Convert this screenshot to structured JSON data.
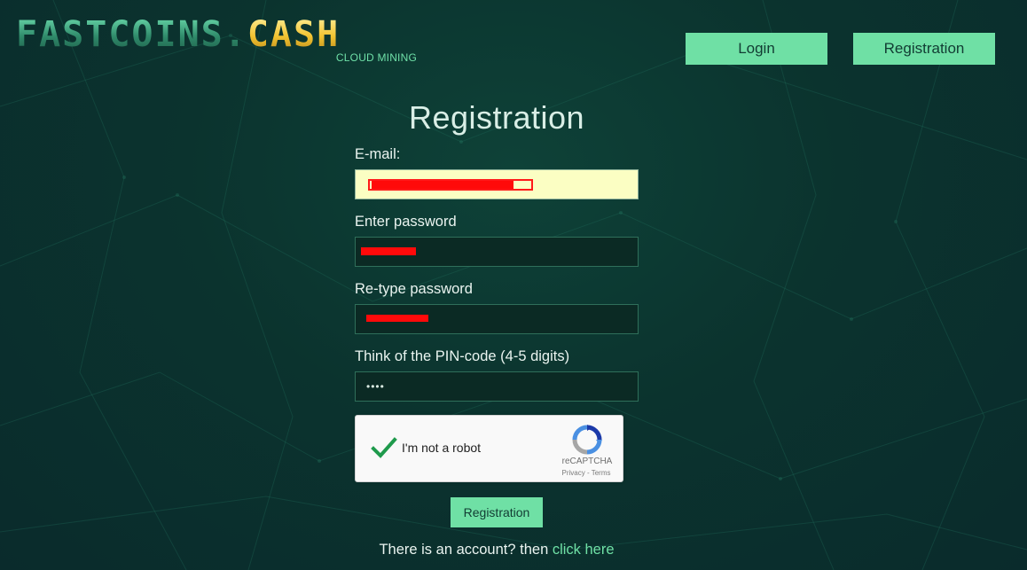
{
  "brand": {
    "logo_part1": "FASTCOINS.",
    "logo_part2": "CASH",
    "tagline": "CLOUD MINING"
  },
  "header": {
    "login_label": "Login",
    "registration_label": "Registration"
  },
  "form": {
    "title": "Registration",
    "email": {
      "label": "E-mail:",
      "value": ""
    },
    "password": {
      "label": "Enter password",
      "value": ""
    },
    "password_repeat": {
      "label": "Re-type password",
      "value": ""
    },
    "pin": {
      "label": "Think of the PIN-code (4-5 digits)",
      "value": "••••"
    },
    "submit_label": "Registration"
  },
  "captcha": {
    "checked": true,
    "label": "I'm not a robot",
    "brand": "reCAPTCHA",
    "links": "Privacy - Terms"
  },
  "footer": {
    "prompt": "There is an account? then",
    "link_text": "click here"
  },
  "colors": {
    "accent": "#6fe0a5",
    "background": "#0b332e",
    "email_field_bg": "#fbfec3"
  }
}
